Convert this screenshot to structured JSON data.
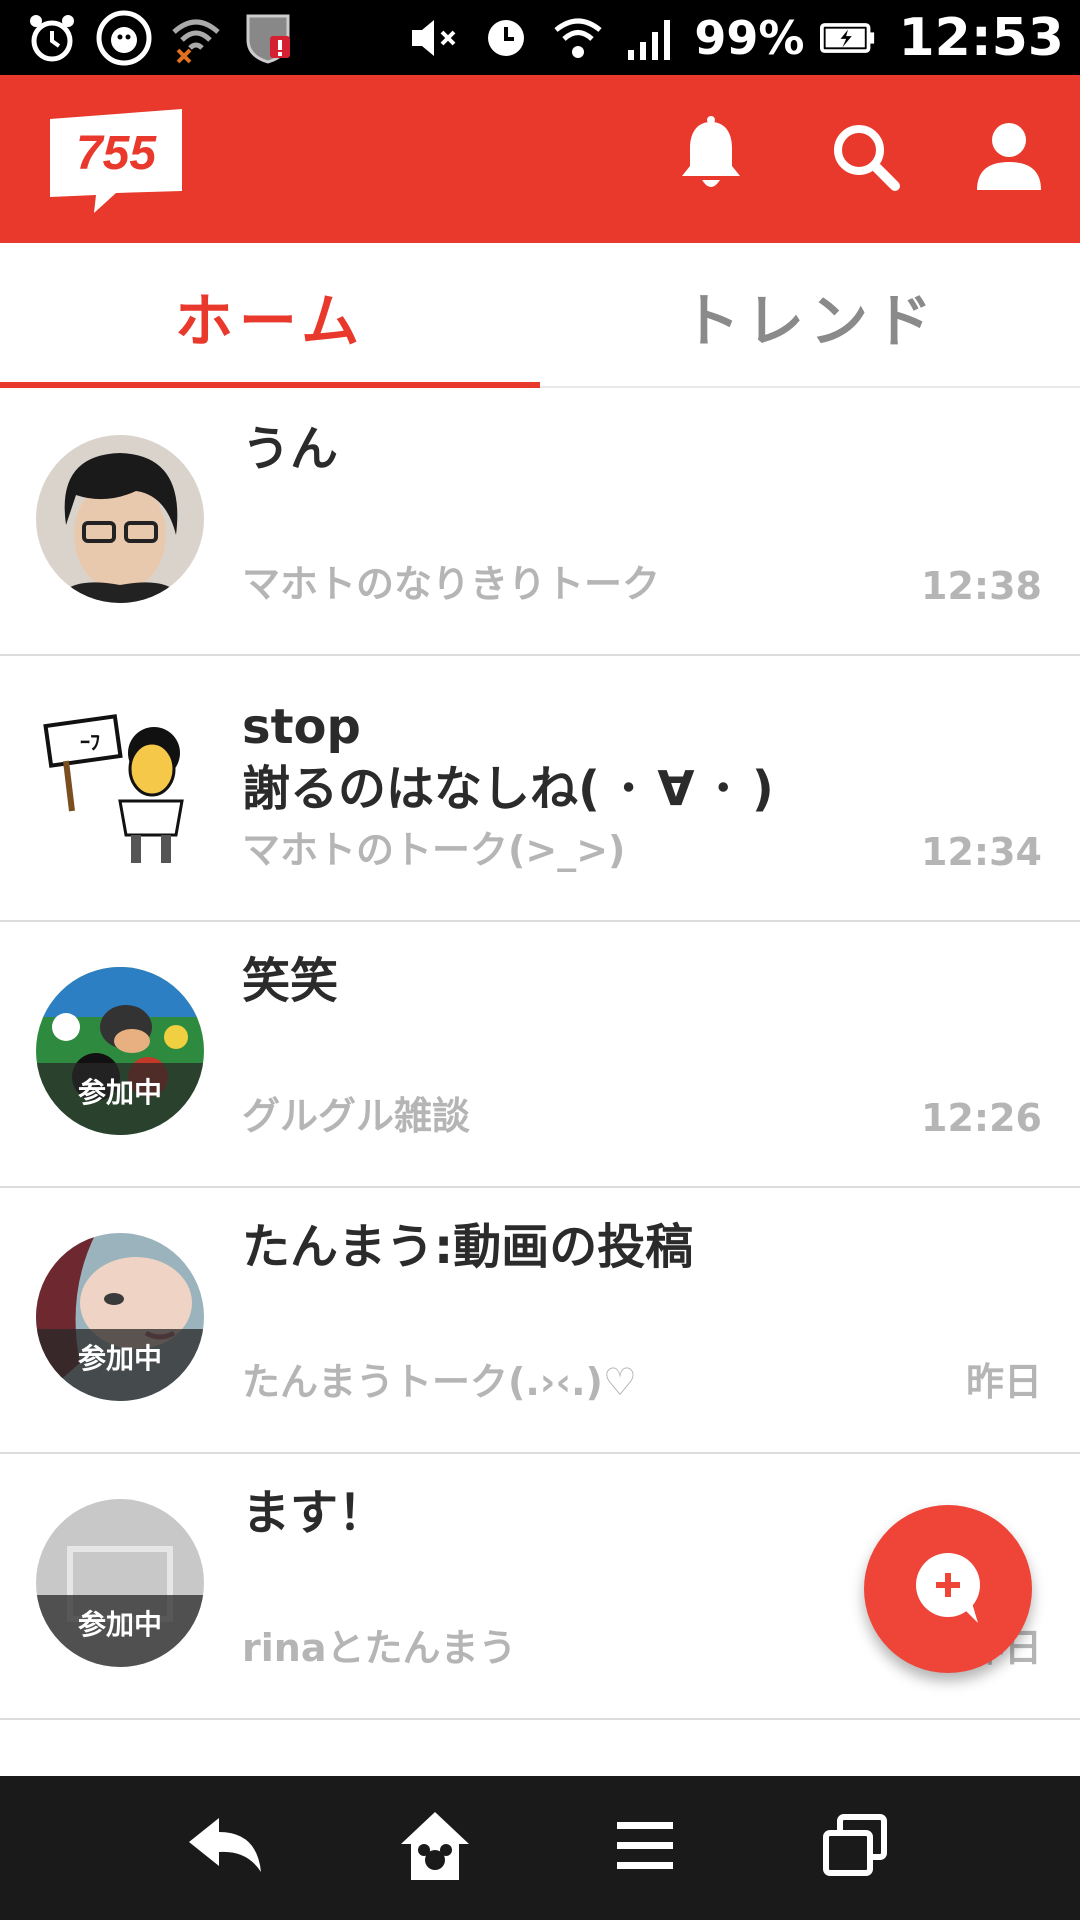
{
  "status_bar": {
    "battery": "99%",
    "time": "12:53"
  },
  "app_bar": {
    "logo_text": "755"
  },
  "tabs": [
    {
      "label": "ホーム",
      "active": true
    },
    {
      "label": "トレンド",
      "active": false
    }
  ],
  "talks": [
    {
      "title": "うん",
      "subtitle": "マホトのなりきりトーク",
      "time": "12:38",
      "joined": false
    },
    {
      "title": "stop\n謝るのはなしね( ･ ∀ ･ )",
      "subtitle": "マホトのトーク(>_>)",
      "time": "12:34",
      "joined": false
    },
    {
      "title": "笑笑",
      "subtitle": "グルグル雑談",
      "time": "12:26",
      "joined": true
    },
    {
      "title": "たんまう:動画の投稿",
      "subtitle": "たんまうトーク(.›‹.)♡",
      "time": "昨日",
      "joined": true
    },
    {
      "title": "ます！",
      "subtitle": "rinaとたんまう",
      "time": "昨日",
      "joined": true
    }
  ],
  "joined_label": "参加中",
  "colors": {
    "accent": "#e8392c",
    "fab": "#ef4438",
    "muted_text": "#b5b5b5"
  }
}
